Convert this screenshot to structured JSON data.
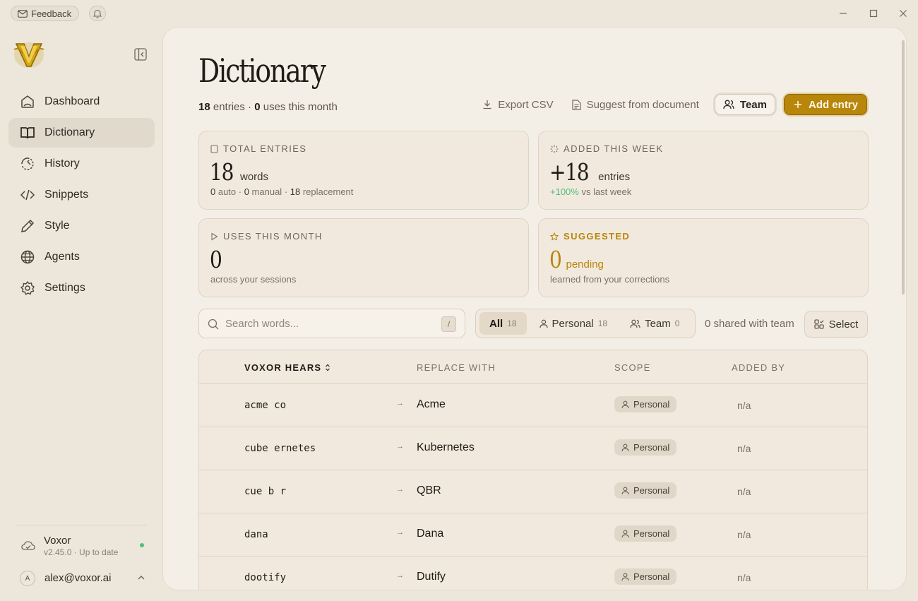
{
  "topbar": {
    "feedback_label": "Feedback"
  },
  "sidebar": {
    "items": [
      {
        "label": "Dashboard",
        "icon": "home-icon"
      },
      {
        "label": "Dictionary",
        "icon": "book-icon",
        "active": true
      },
      {
        "label": "History",
        "icon": "history-icon"
      },
      {
        "label": "Snippets",
        "icon": "code-icon"
      },
      {
        "label": "Style",
        "icon": "pen-icon"
      },
      {
        "label": "Agents",
        "icon": "globe-icon"
      },
      {
        "label": "Settings",
        "icon": "gear-icon"
      }
    ],
    "version": {
      "title": "Voxor",
      "subtitle": "v2.45.0 · Up to date"
    },
    "account": {
      "avatar": "A",
      "email": "alex@voxor.ai"
    }
  },
  "header": {
    "title": "Dictionary",
    "entries_count": "18",
    "entries_label": " entries · ",
    "uses_count": "0",
    "uses_label": " uses this month",
    "export_label": "Export CSV",
    "suggest_label": "Suggest from document",
    "team_label": "Team",
    "add_label": "Add entry"
  },
  "stats": {
    "total": {
      "label": "TOTAL ENTRIES",
      "value": "18",
      "unit": "words",
      "note_auto": "0",
      "note_auto_label": " auto · ",
      "note_manual": "0",
      "note_manual_label": " manual · ",
      "note_repl": "18",
      "note_repl_label": " replacement"
    },
    "week": {
      "label": "ADDED THIS WEEK",
      "value": "+18",
      "unit": "entries",
      "change": "+100%",
      "change_label": " vs last week"
    },
    "uses": {
      "label": "USES THIS MONTH",
      "value": "0",
      "note": "across your sessions"
    },
    "suggested": {
      "label": "SUGGESTED",
      "value": "0",
      "unit": "pending",
      "note": "learned from your corrections"
    }
  },
  "toolbar": {
    "search_placeholder": "Search words...",
    "search_shortcut": "/",
    "filters": [
      {
        "label": "All",
        "count": "18"
      },
      {
        "label": "Personal",
        "count": "18"
      },
      {
        "label": "Team",
        "count": "0"
      }
    ],
    "shared_text": "0 shared with team",
    "select_label": "Select"
  },
  "table": {
    "columns": [
      "VOXOR HEARS",
      "REPLACE WITH",
      "SCOPE",
      "ADDED BY"
    ],
    "arrow": "→",
    "rows": [
      {
        "hears": "acme co",
        "replace": "Acme",
        "scope": "Personal",
        "added_by": "n/a"
      },
      {
        "hears": "cube ernetes",
        "replace": "Kubernetes",
        "scope": "Personal",
        "added_by": "n/a"
      },
      {
        "hears": "cue b r",
        "replace": "QBR",
        "scope": "Personal",
        "added_by": "n/a"
      },
      {
        "hears": "dana",
        "replace": "Dana",
        "scope": "Personal",
        "added_by": "n/a"
      },
      {
        "hears": "dootify",
        "replace": "Dutify",
        "scope": "Personal",
        "added_by": "n/a"
      }
    ]
  },
  "colors": {
    "accent": "#b8860b",
    "background": "#ede6da",
    "panel": "#f4efe6",
    "positive": "#4ec07a"
  }
}
